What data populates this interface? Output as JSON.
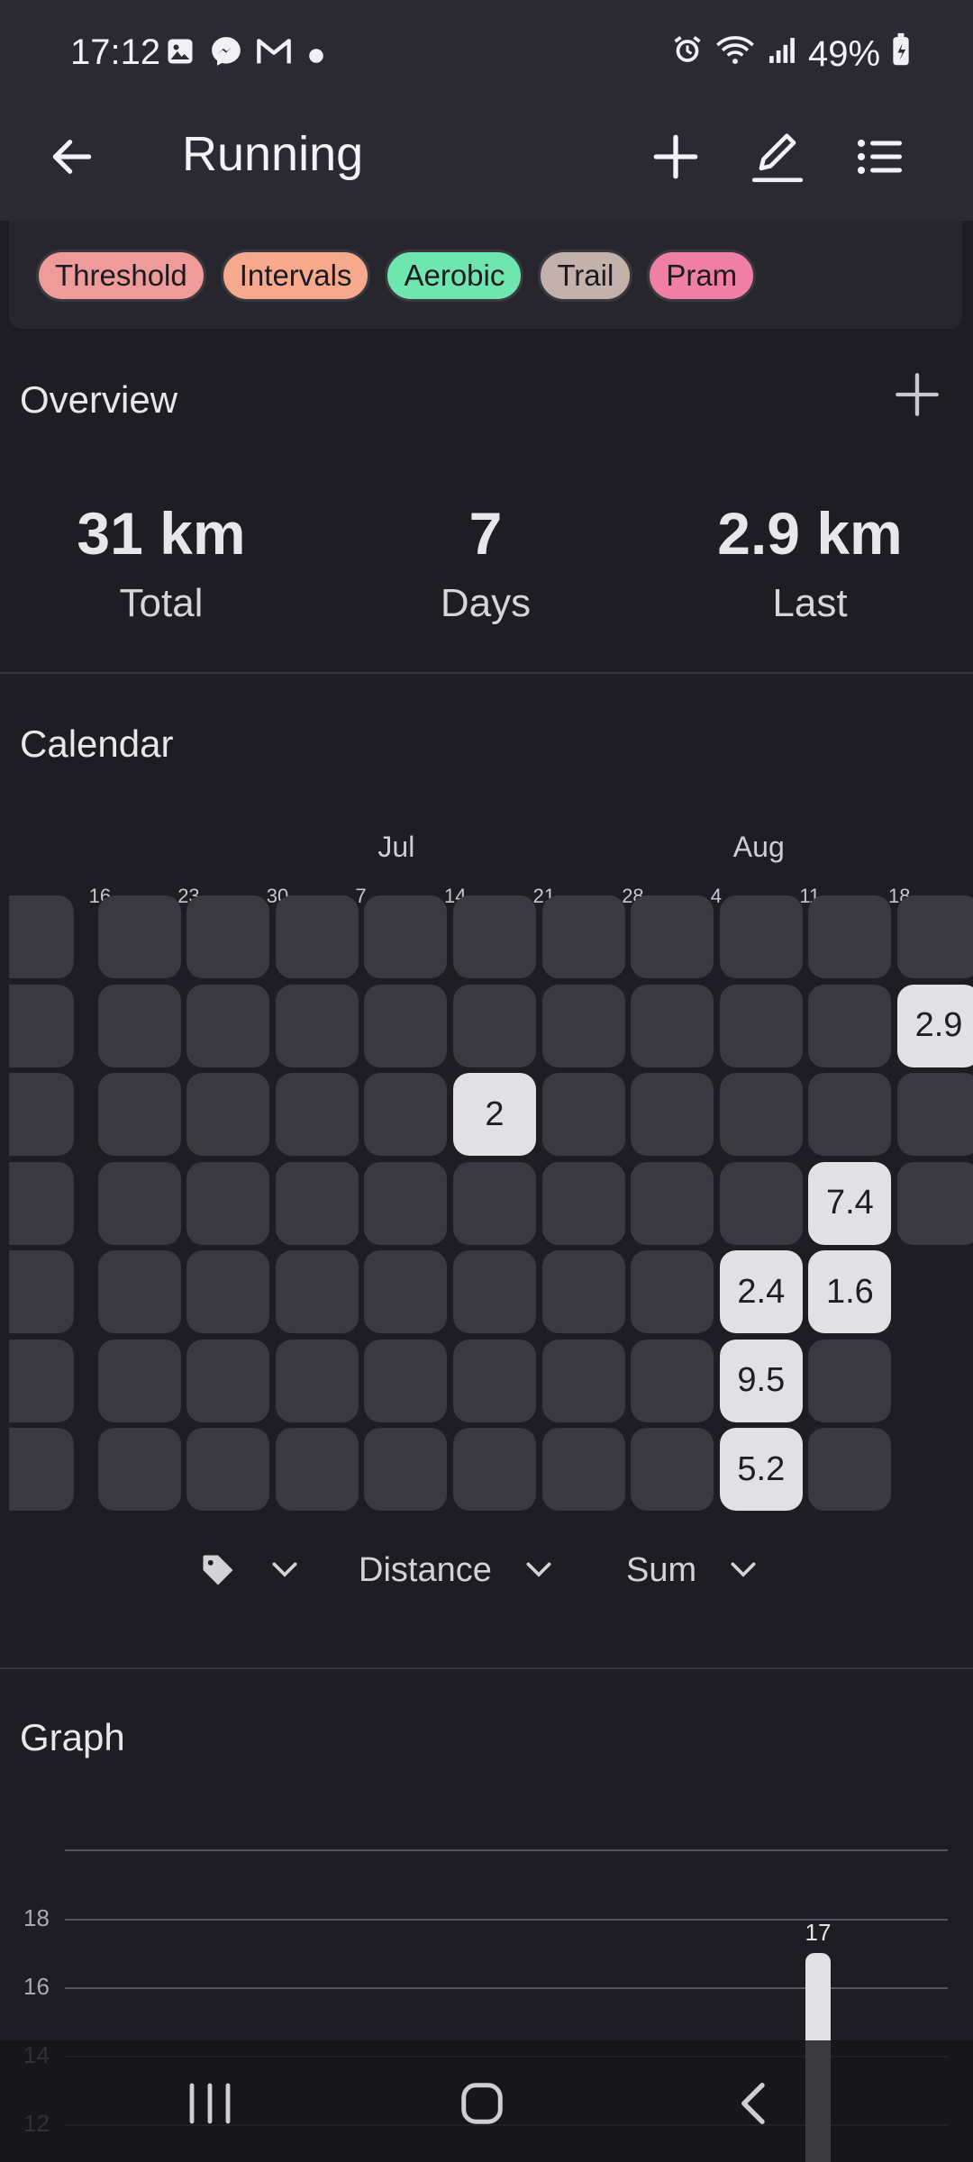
{
  "status_bar": {
    "time": "17:12",
    "left_icons": [
      "gallery-icon",
      "messenger-icon",
      "gmail-icon",
      "dot-icon"
    ],
    "right_icons": [
      "alarm-icon",
      "wifi-icon",
      "signal-icon"
    ],
    "battery": "49%"
  },
  "app_bar": {
    "title": "Running",
    "actions": [
      "add-icon",
      "edit-icon",
      "list-icon"
    ]
  },
  "tags": [
    {
      "label": "Threshold",
      "color": "#ee9b9a"
    },
    {
      "label": "Intervals",
      "color": "#f6a98c"
    },
    {
      "label": "Aerobic",
      "color": "#6fe6b0"
    },
    {
      "label": "Trail",
      "color": "#c2b2ab"
    },
    {
      "label": "Pram",
      "color": "#f07fa6"
    }
  ],
  "overview": {
    "title": "Overview",
    "stats": [
      {
        "value": "31 km",
        "label": "Total"
      },
      {
        "value": "7",
        "label": "Days"
      },
      {
        "value": "2.9 km",
        "label": "Last"
      }
    ]
  },
  "calendar": {
    "title": "Calendar",
    "months": [
      "Jul",
      "Aug"
    ],
    "weeks": [
      "16",
      "23",
      "30",
      "7",
      "14",
      "21",
      "28",
      "4",
      "11",
      "18"
    ],
    "entries": [
      {
        "week": 10,
        "day": 1,
        "value": "2.9"
      },
      {
        "week": 5,
        "day": 2,
        "value": "2"
      },
      {
        "week": 9,
        "day": 3,
        "value": "7.4"
      },
      {
        "week": 8,
        "day": 4,
        "value": "2.4"
      },
      {
        "week": 9,
        "day": 4,
        "value": "1.6"
      },
      {
        "week": 8,
        "day": 5,
        "value": "9.5"
      },
      {
        "week": 8,
        "day": 6,
        "value": "5.2"
      }
    ],
    "controls": {
      "tag_filter_icon": "tag-icon",
      "metric": "Distance",
      "aggregate": "Sum"
    }
  },
  "graph": {
    "title": "Graph",
    "chart_data": {
      "type": "bar",
      "y_ticks": [
        "18",
        "16",
        "14",
        "12"
      ],
      "values": [
        17
      ],
      "value_labels": [
        "17"
      ]
    }
  },
  "nav_bar": {
    "buttons": [
      "recent-apps-icon",
      "home-icon",
      "back-icon"
    ]
  }
}
